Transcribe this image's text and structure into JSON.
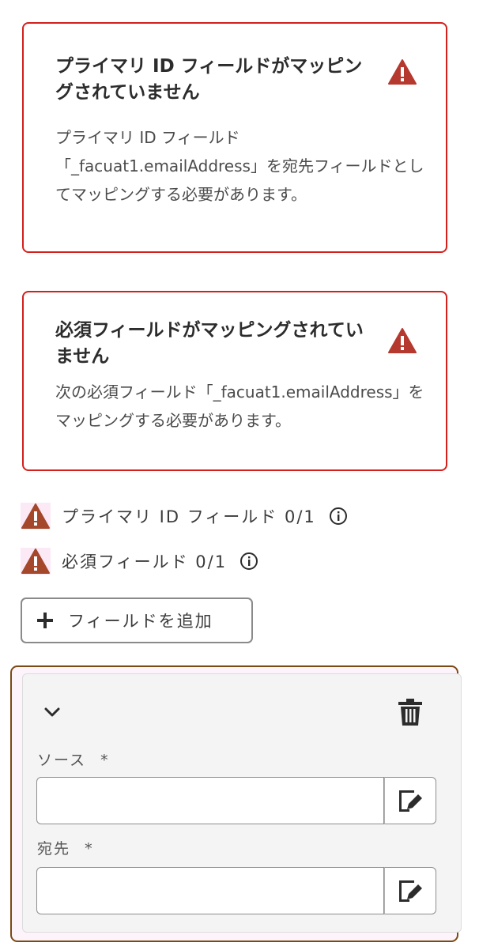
{
  "alerts": [
    {
      "title": "プライマリ ID フィールドがマッピングされていません",
      "body": "プライマリ ID フィールド「_facuat1.emailAddress」を宛先フィールドとしてマッピングする必要があります。"
    },
    {
      "title": "必須フィールドがマッピングされていません",
      "body": "次の必須フィールド「_facuat1.emailAddress」をマッピングする必要があります。"
    }
  ],
  "status": {
    "primary_id_label": "プライマリ ID フィールド 0/1",
    "required_label": "必須フィールド 0/1"
  },
  "add_field_label": "フィールドを追加",
  "mapping": {
    "source_label": "ソース",
    "destination_label": "宛先",
    "required_mark": "*",
    "source_value": "",
    "destination_value": ""
  },
  "colors": {
    "error": "#d3201c",
    "warning_icon": "#b5392e",
    "selected_border": "#7a4a12"
  },
  "icons": [
    "alert-icon",
    "info-icon",
    "plus-icon",
    "chevron-down-icon",
    "trash-icon",
    "edit-icon"
  ]
}
